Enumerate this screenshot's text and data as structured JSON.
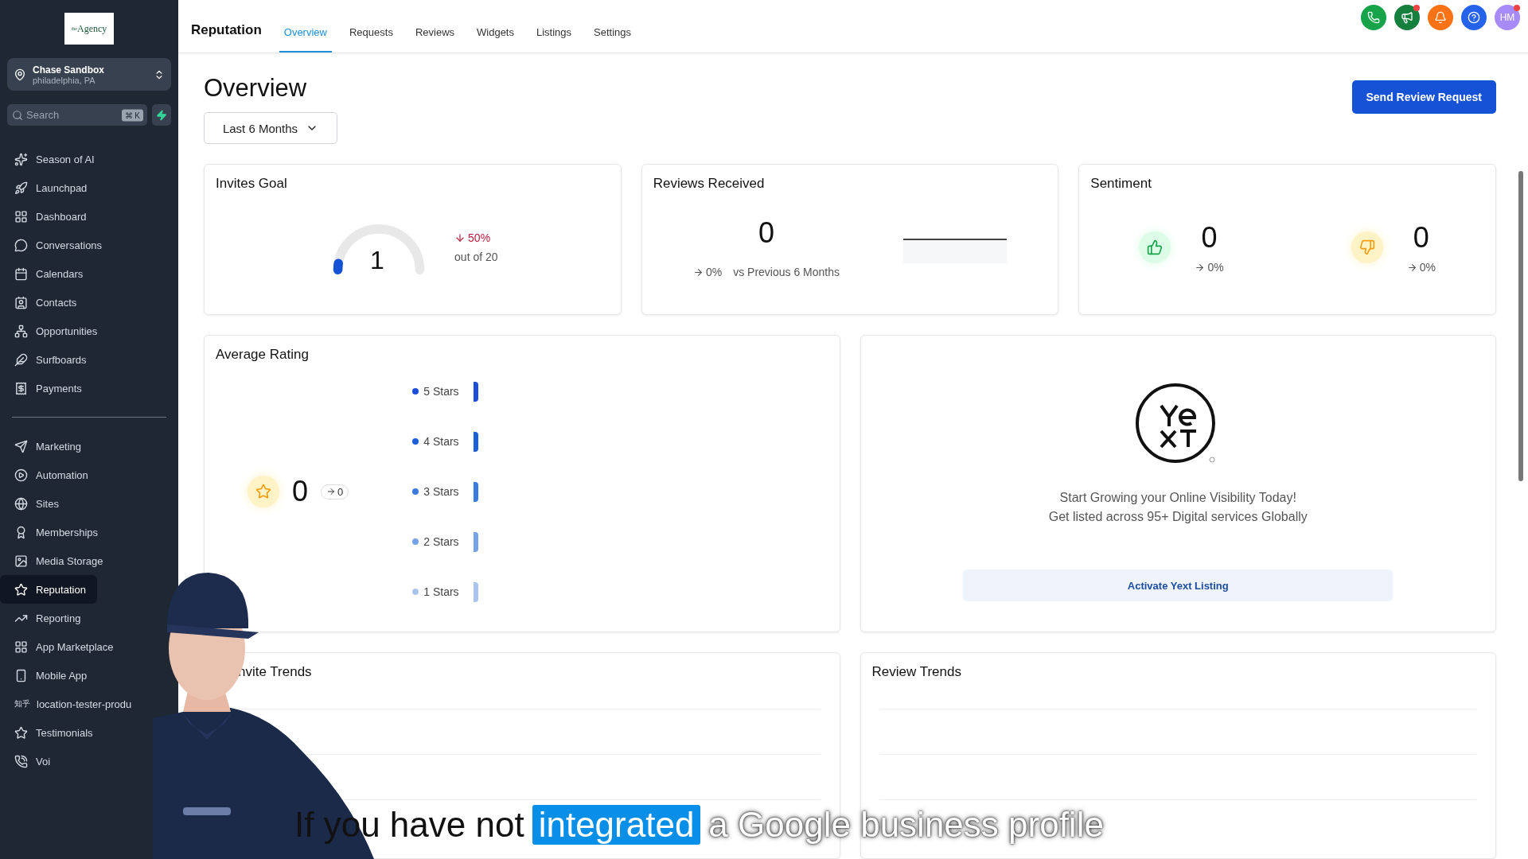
{
  "sidebar": {
    "logo": {
      "small": "the",
      "name": "Agency"
    },
    "account": {
      "name": "Chase Sandbox",
      "location": "philadelphia, PA"
    },
    "search": {
      "placeholder": "Search",
      "shortcut": "⌘ K"
    },
    "groups": [
      [
        {
          "label": "Season of AI",
          "selected": false
        },
        {
          "label": "Launchpad",
          "selected": false
        },
        {
          "label": "Dashboard",
          "selected": false
        },
        {
          "label": "Conversations",
          "selected": false
        },
        {
          "label": "Calendars",
          "selected": false
        },
        {
          "label": "Contacts",
          "selected": false
        },
        {
          "label": "Opportunities",
          "selected": false
        },
        {
          "label": "Surfboards",
          "selected": false
        },
        {
          "label": "Payments",
          "selected": false
        }
      ],
      [
        {
          "label": "Marketing",
          "selected": false
        },
        {
          "label": "Automation",
          "selected": false
        },
        {
          "label": "Sites",
          "selected": false
        },
        {
          "label": "Memberships",
          "selected": false
        },
        {
          "label": "Media Storage",
          "selected": false
        },
        {
          "label": "Reputation",
          "selected": true
        },
        {
          "label": "Reporting",
          "selected": false
        },
        {
          "label": "App Marketplace",
          "selected": false
        },
        {
          "label": "Mobile App",
          "selected": false
        },
        {
          "label": "location-tester-produ",
          "glyph": "知乎",
          "selected": false
        },
        {
          "label": "Testimonials",
          "selected": false
        },
        {
          "label": "Voi",
          "selected": false
        }
      ]
    ]
  },
  "header": {
    "title": "Reputation",
    "tabs": [
      {
        "label": "Overview",
        "selected": true
      },
      {
        "label": "Requests",
        "selected": false
      },
      {
        "label": "Reviews",
        "selected": false
      },
      {
        "label": "Widgets",
        "selected": false
      },
      {
        "label": "Listings",
        "selected": false
      },
      {
        "label": "Settings",
        "selected": false
      }
    ],
    "actions": [
      {
        "kind": "phone",
        "color": "#16a34a",
        "dot": false
      },
      {
        "kind": "megaphone",
        "color": "#15803d",
        "dot": true
      },
      {
        "kind": "bell",
        "color": "#f97316",
        "dot": false
      },
      {
        "kind": "help",
        "color": "#2563eb",
        "dot": false
      },
      {
        "kind": "avatar",
        "color": "#a78bfa",
        "text": "HM",
        "dot": true
      }
    ]
  },
  "page": {
    "title": "Overview",
    "period": "Last 6 Months",
    "primary_button": "Send Review Request"
  },
  "invites_goal": {
    "title": "Invites Goal",
    "value": "1",
    "level": 0.05,
    "change": "50%",
    "target": "out of 20"
  },
  "reviews_received": {
    "title": "Reviews Received",
    "value": "0",
    "change": "0%",
    "comparison": "vs Previous 6 Months"
  },
  "sentiment": {
    "title": "Sentiment",
    "items": [
      {
        "kind": "positive",
        "value": "0",
        "change": "0%"
      },
      {
        "kind": "negative",
        "value": "0",
        "change": "0%"
      }
    ]
  },
  "average_rating": {
    "title": "Average Rating",
    "value": "0",
    "change": "0",
    "breakdown": [
      {
        "label": "5 Stars",
        "color": "#1d4ed8"
      },
      {
        "label": "4 Stars",
        "color": "#1d5fd8"
      },
      {
        "label": "3 Stars",
        "color": "#3b7be0"
      },
      {
        "label": "2 Stars",
        "color": "#76a3e8"
      },
      {
        "label": "1 Stars",
        "color": "#aac4f0"
      }
    ]
  },
  "yext": {
    "line_1": "Start Growing your Online Visibility Today!",
    "line_2": "Get listed across 95+ Digital services Globally",
    "button": "Activate Yext Listing"
  },
  "trends": [
    {
      "title": "nvite Trends"
    },
    {
      "title": "Review Trends"
    }
  ],
  "caption": {
    "lead": "If you have not",
    "highlight": "integrated",
    "rest": "a Google business profile"
  }
}
